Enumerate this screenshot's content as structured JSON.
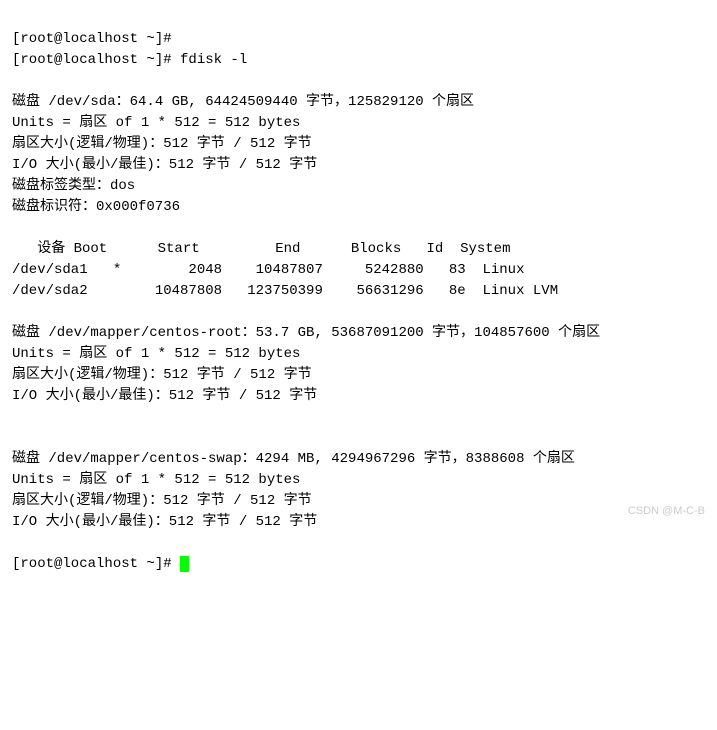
{
  "lines": {
    "0": "[root@localhost ~]#",
    "1": "[root@localhost ~]# fdisk -l",
    "2": "磁盘 /dev/sda：64.4 GB, 64424509440 字节，125829120 个扇区",
    "3": "Units = 扇区 of 1 * 512 = 512 bytes",
    "4": "扇区大小(逻辑/物理)：512 字节 / 512 字节",
    "5": "I/O 大小(最小/最佳)：512 字节 / 512 字节",
    "6": "磁盘标签类型：dos",
    "7": "磁盘标识符：0x000f0736",
    "8": "   设备 Boot      Start         End      Blocks   Id  System",
    "9": "/dev/sda1   *        2048    10487807     5242880   83  Linux",
    "10": "/dev/sda2        10487808   123750399    56631296   8e  Linux LVM",
    "11": "磁盘 /dev/mapper/centos-root：53.7 GB, 53687091200 字节，104857600 个扇区",
    "12": "Units = 扇区 of 1 * 512 = 512 bytes",
    "13": "扇区大小(逻辑/物理)：512 字节 / 512 字节",
    "14": "I/O 大小(最小/最佳)：512 字节 / 512 字节",
    "15": "磁盘 /dev/mapper/centos-swap：4294 MB, 4294967296 字节，8388608 个扇区",
    "16": "Units = 扇区 of 1 * 512 = 512 bytes",
    "17": "扇区大小(逻辑/物理)：512 字节 / 512 字节",
    "18": "I/O 大小(最小/最佳)：512 字节 / 512 字节",
    "19": "[root@localhost ~]# "
  },
  "watermark": "CSDN @M-C-B",
  "disks": [
    {
      "device": "/dev/sda",
      "size_gb": 64.4,
      "bytes": 64424509440,
      "sectors": 125829120,
      "units": "扇区 of 1 * 512 = 512 bytes",
      "sector_size": "512 字节 / 512 字节",
      "io_size": "512 字节 / 512 字节",
      "label_type": "dos",
      "identifier": "0x000f0736",
      "partitions": [
        {
          "device": "/dev/sda1",
          "boot": "*",
          "start": 2048,
          "end": 10487807,
          "blocks": 5242880,
          "id": "83",
          "system": "Linux"
        },
        {
          "device": "/dev/sda2",
          "boot": "",
          "start": 10487808,
          "end": 123750399,
          "blocks": 56631296,
          "id": "8e",
          "system": "Linux LVM"
        }
      ]
    },
    {
      "device": "/dev/mapper/centos-root",
      "size_gb": 53.7,
      "bytes": 53687091200,
      "sectors": 104857600,
      "units": "扇区 of 1 * 512 = 512 bytes",
      "sector_size": "512 字节 / 512 字节",
      "io_size": "512 字节 / 512 字节"
    },
    {
      "device": "/dev/mapper/centos-swap",
      "size_mb": 4294,
      "bytes": 4294967296,
      "sectors": 8388608,
      "units": "扇区 of 1 * 512 = 512 bytes",
      "sector_size": "512 字节 / 512 字节",
      "io_size": "512 字节 / 512 字节"
    }
  ],
  "command": "fdisk -l",
  "prompt": "[root@localhost ~]#"
}
